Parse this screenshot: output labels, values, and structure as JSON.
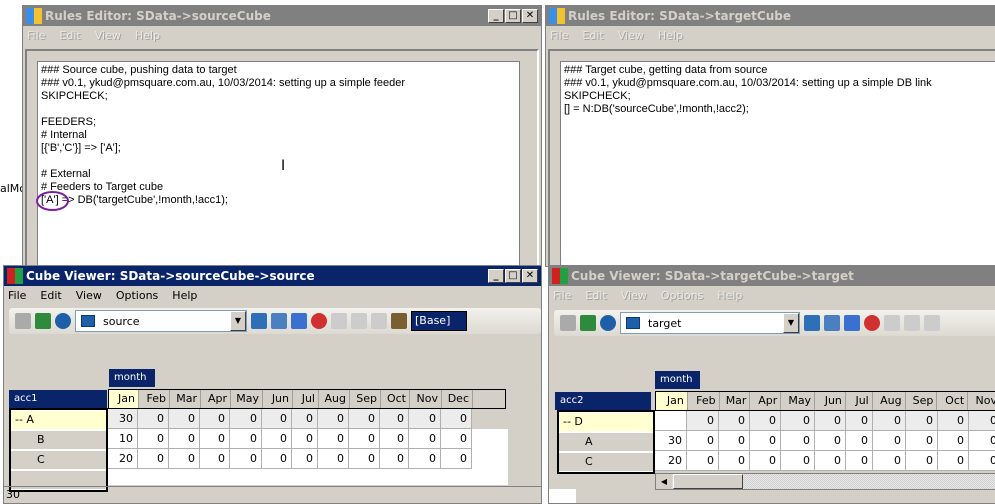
{
  "background_text": "alMc",
  "rules_source": {
    "title": "Rules Editor:  SData->sourceCube",
    "menu": [
      "File",
      "Edit",
      "View",
      "Help"
    ],
    "code": "### Source cube, pushing data to target\n### v0.1, ykud@pmsquare.com.au, 10/03/2014: setting up a simple feeder\nSKIPCHECK;\n\nFEEDERS;\n# Internal\n[{'B','C'}] => ['A'];\n\n# External\n# Feeders to Target cube\n['A'] => DB('targetCube',!month,!acc1);"
  },
  "rules_target": {
    "title": "Rules Editor:  SData->targetCube",
    "menu": [
      "File",
      "Edit",
      "View",
      "Help"
    ],
    "code": "### Target cube, getting data from source\n### v0.1, ykud@pmsquare.com.au, 10/03/2014: setting up a simple DB link\nSKIPCHECK;\n[] = N:DB('sourceCube',!month,!acc2);"
  },
  "viewer_source": {
    "title": "Cube Viewer: SData->sourceCube->source",
    "menu": [
      "File",
      "Edit",
      "View",
      "Options",
      "Help"
    ],
    "view": "source",
    "subset": "[Base]",
    "column_dim": "month",
    "row_dim": "acc1",
    "columns": [
      "Jan",
      "Feb",
      "Mar",
      "Apr",
      "May",
      "Jun",
      "Jul",
      "Aug",
      "Sep",
      "Oct",
      "Nov",
      "Dec"
    ],
    "rows": [
      {
        "label": "-- A",
        "values": [
          "30",
          "0",
          "0",
          "0",
          "0",
          "0",
          "0",
          "0",
          "0",
          "0",
          "0",
          "0"
        ]
      },
      {
        "label": "B",
        "values": [
          "10",
          "0",
          "0",
          "0",
          "0",
          "0",
          "0",
          "0",
          "0",
          "0",
          "0",
          "0"
        ]
      },
      {
        "label": "C",
        "values": [
          "20",
          "0",
          "0",
          "0",
          "0",
          "0",
          "0",
          "0",
          "0",
          "0",
          "0",
          "0"
        ]
      }
    ],
    "status": "30"
  },
  "viewer_target": {
    "title": "Cube Viewer: SData->targetCube->target",
    "menu": [
      "File",
      "Edit",
      "View",
      "Options",
      "Help"
    ],
    "view": "target",
    "column_dim": "month",
    "row_dim": "acc2",
    "columns": [
      "Jan",
      "Feb",
      "Mar",
      "Apr",
      "May",
      "Jun",
      "Jul",
      "Aug",
      "Sep",
      "Oct",
      "Nov"
    ],
    "rows": [
      {
        "label": "-- D",
        "values": [
          "",
          "0",
          "0",
          "0",
          "0",
          "0",
          "0",
          "0",
          "0",
          "0",
          "0"
        ]
      },
      {
        "label": "A",
        "values": [
          "30",
          "0",
          "0",
          "0",
          "0",
          "0",
          "0",
          "0",
          "0",
          "0",
          "0"
        ]
      },
      {
        "label": "C",
        "values": [
          "20",
          "0",
          "0",
          "0",
          "0",
          "0",
          "0",
          "0",
          "0",
          "0",
          "0"
        ]
      }
    ]
  },
  "colors": {
    "active_title": "#0a246a",
    "inactive_title": "#808080",
    "selected_cell": "#ffffd0",
    "highlight_circle": "#7a1fa2"
  }
}
